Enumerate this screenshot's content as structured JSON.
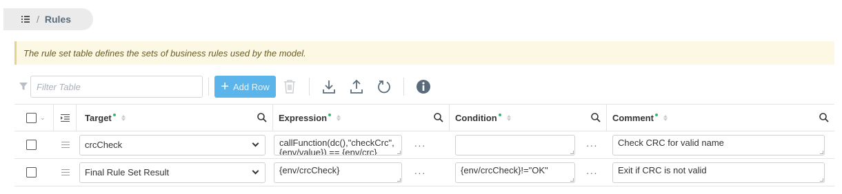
{
  "breadcrumb": {
    "icon": "list-icon",
    "separator": "/",
    "title": "Rules"
  },
  "banner": {
    "text": "The rule set table defines the sets of business rules used by the model."
  },
  "toolbar": {
    "filter_placeholder": "Filter Table",
    "add_row_label": "Add Row",
    "add_row_icon": "+",
    "icons": [
      "filter-icon",
      "trash-icon",
      "download-icon",
      "upload-icon",
      "refresh-icon",
      "info-icon"
    ]
  },
  "table": {
    "columns": [
      {
        "name": "Target",
        "required": true
      },
      {
        "name": "Expression",
        "required": true
      },
      {
        "name": "Condition",
        "required": true
      },
      {
        "name": "Comment",
        "required": true
      }
    ],
    "rows": [
      {
        "target": "crcCheck",
        "expression": "callFunction(dc(),\"checkCrc\", {env/value}) == {env/crc}",
        "condition": "",
        "comment": "Check CRC for valid name"
      },
      {
        "target": "Final Rule Set Result",
        "expression": "{env/crcCheck}",
        "condition": "{env/crcCheck}!=\"OK\"",
        "comment": "Exit if CRC is not valid"
      }
    ],
    "more_label": "···"
  },
  "colors": {
    "accent": "#5bb4ea",
    "banner_bg": "#fcf8e3",
    "banner_border": "#e6d48a",
    "required_dot": "#3cb371",
    "breadcrumb_bg": "#ebebeb"
  }
}
